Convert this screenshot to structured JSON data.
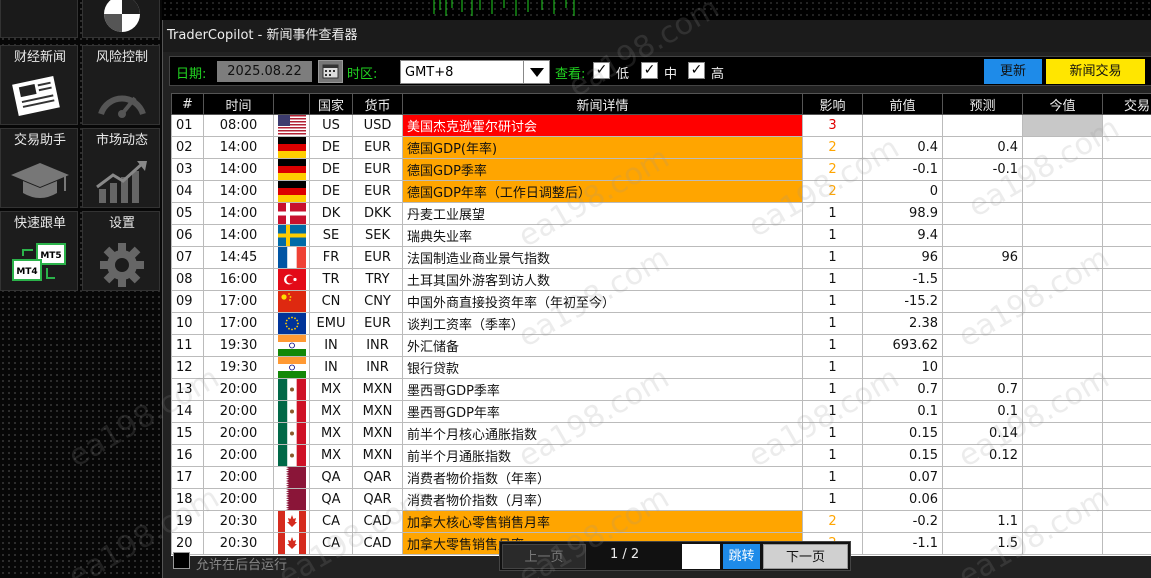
{
  "window": {
    "title": "TraderCopilot - 新闻事件查看器"
  },
  "sidebar": {
    "items": [
      {
        "label": "财经新闻",
        "icon": "newspaper-icon"
      },
      {
        "label": "风险控制",
        "icon": "gauge-icon"
      },
      {
        "label": "交易助手",
        "icon": "graduation-cap-icon"
      },
      {
        "label": "市场动态",
        "icon": "trend-chart-icon"
      },
      {
        "label": "快速跟单",
        "icon": "mt4-mt5-copy-icon"
      },
      {
        "label": "设置",
        "icon": "gear-icon"
      }
    ]
  },
  "toolbar": {
    "date_label": "日期:",
    "date_value": "2025.08.22",
    "timezone_label": "时区:",
    "timezone_value": "GMT+8",
    "view_label": "查看:",
    "filters": [
      {
        "label": "低",
        "checked": true
      },
      {
        "label": "中",
        "checked": true
      },
      {
        "label": "高",
        "checked": true
      }
    ],
    "refresh_label": "更新",
    "news_trade_label": "新闻交易"
  },
  "table": {
    "headers": [
      "#",
      "时间",
      "",
      "国家",
      "货币",
      "新闻详情",
      "影响",
      "前值",
      "预测",
      "今值",
      "交易"
    ],
    "rows": [
      {
        "no": "01",
        "time": "08:00",
        "flag": "us",
        "country": "US",
        "currency": "USD",
        "event": "美国杰克逊霍尔研讨会",
        "impact": "3",
        "prev": "",
        "forecast": "",
        "actual": "",
        "level": "high",
        "trade": ""
      },
      {
        "no": "02",
        "time": "14:00",
        "flag": "de",
        "country": "DE",
        "currency": "EUR",
        "event": "德国GDP(年率)",
        "impact": "2",
        "prev": "0.4",
        "forecast": "0.4",
        "actual": "",
        "level": "mid",
        "trade": "+"
      },
      {
        "no": "03",
        "time": "14:00",
        "flag": "de",
        "country": "DE",
        "currency": "EUR",
        "event": "德国GDP季率",
        "impact": "2",
        "prev": "-0.1",
        "forecast": "-0.1",
        "actual": "",
        "level": "mid",
        "trade": "+"
      },
      {
        "no": "04",
        "time": "14:00",
        "flag": "de",
        "country": "DE",
        "currency": "EUR",
        "event": "德国GDP年率（工作日调整后）",
        "impact": "2",
        "prev": "0",
        "forecast": "",
        "actual": "",
        "level": "mid",
        "trade": "+"
      },
      {
        "no": "05",
        "time": "14:00",
        "flag": "dk",
        "country": "DK",
        "currency": "DKK",
        "event": "丹麦工业展望",
        "impact": "1",
        "prev": "98.9",
        "forecast": "",
        "actual": "",
        "level": "low",
        "trade": "+"
      },
      {
        "no": "06",
        "time": "14:00",
        "flag": "se",
        "country": "SE",
        "currency": "SEK",
        "event": "瑞典失业率",
        "impact": "1",
        "prev": "9.4",
        "forecast": "",
        "actual": "",
        "level": "low",
        "trade": "+"
      },
      {
        "no": "07",
        "time": "14:45",
        "flag": "fr",
        "country": "FR",
        "currency": "EUR",
        "event": "法国制造业商业景气指数",
        "impact": "1",
        "prev": "96",
        "forecast": "96",
        "actual": "",
        "level": "low",
        "trade": "+"
      },
      {
        "no": "08",
        "time": "16:00",
        "flag": "tr",
        "country": "TR",
        "currency": "TRY",
        "event": "土耳其国外游客到访人数",
        "impact": "1",
        "prev": "-1.5",
        "forecast": "",
        "actual": "",
        "level": "low",
        "trade": "+"
      },
      {
        "no": "09",
        "time": "17:00",
        "flag": "cn",
        "country": "CN",
        "currency": "CNY",
        "event": "中国外商直接投资年率（年初至今）",
        "impact": "1",
        "prev": "-15.2",
        "forecast": "",
        "actual": "",
        "level": "low",
        "trade": "+"
      },
      {
        "no": "10",
        "time": "17:00",
        "flag": "eu",
        "country": "EMU",
        "currency": "EUR",
        "event": "谈判工资率（季率）",
        "impact": "1",
        "prev": "2.38",
        "forecast": "",
        "actual": "",
        "level": "low",
        "trade": "+"
      },
      {
        "no": "11",
        "time": "19:30",
        "flag": "in",
        "country": "IN",
        "currency": "INR",
        "event": "外汇储备",
        "impact": "1",
        "prev": "693.62",
        "forecast": "",
        "actual": "",
        "level": "low",
        "trade": "+"
      },
      {
        "no": "12",
        "time": "19:30",
        "flag": "in",
        "country": "IN",
        "currency": "INR",
        "event": "银行贷款",
        "impact": "1",
        "prev": "10",
        "forecast": "",
        "actual": "",
        "level": "low",
        "trade": "+"
      },
      {
        "no": "13",
        "time": "20:00",
        "flag": "mx",
        "country": "MX",
        "currency": "MXN",
        "event": "墨西哥GDP季率",
        "impact": "1",
        "prev": "0.7",
        "forecast": "0.7",
        "actual": "",
        "level": "low",
        "trade": "+"
      },
      {
        "no": "14",
        "time": "20:00",
        "flag": "mx",
        "country": "MX",
        "currency": "MXN",
        "event": "墨西哥GDP年率",
        "impact": "1",
        "prev": "0.1",
        "forecast": "0.1",
        "actual": "",
        "level": "low",
        "trade": "+"
      },
      {
        "no": "15",
        "time": "20:00",
        "flag": "mx",
        "country": "MX",
        "currency": "MXN",
        "event": "前半个月核心通胀指数",
        "impact": "1",
        "prev": "0.15",
        "forecast": "0.14",
        "actual": "",
        "level": "low",
        "trade": "+"
      },
      {
        "no": "16",
        "time": "20:00",
        "flag": "mx",
        "country": "MX",
        "currency": "MXN",
        "event": "前半个月通胀指数",
        "impact": "1",
        "prev": "0.15",
        "forecast": "0.12",
        "actual": "",
        "level": "low",
        "trade": "+"
      },
      {
        "no": "17",
        "time": "20:00",
        "flag": "qa",
        "country": "QA",
        "currency": "QAR",
        "event": "消费者物价指数（年率）",
        "impact": "1",
        "prev": "0.07",
        "forecast": "",
        "actual": "",
        "level": "low",
        "trade": "+"
      },
      {
        "no": "18",
        "time": "20:00",
        "flag": "qa",
        "country": "QA",
        "currency": "QAR",
        "event": "消费者物价指数（月率）",
        "impact": "1",
        "prev": "0.06",
        "forecast": "",
        "actual": "",
        "level": "low",
        "trade": "+"
      },
      {
        "no": "19",
        "time": "20:30",
        "flag": "ca",
        "country": "CA",
        "currency": "CAD",
        "event": "加拿大核心零售销售月率",
        "impact": "2",
        "prev": "-0.2",
        "forecast": "1.1",
        "actual": "",
        "level": "mid",
        "trade": "+"
      },
      {
        "no": "20",
        "time": "20:30",
        "flag": "ca",
        "country": "CA",
        "currency": "CAD",
        "event": "加拿大零售销售月率",
        "impact": "2",
        "prev": "-1.1",
        "forecast": "1.5",
        "actual": "",
        "level": "mid",
        "trade": "+"
      }
    ]
  },
  "footer": {
    "background_run_label": "允许在后台运行",
    "prev_label": "上一页",
    "page_info": "1 / 2",
    "jump_label": "跳转",
    "next_label": "下一页"
  },
  "watermark": "ea198.com",
  "colors": {
    "high": "#ff0000",
    "mid": "#ffa500",
    "accent_blue": "#1e8be9",
    "accent_yellow": "#ffe600",
    "label_green": "#21d321"
  }
}
